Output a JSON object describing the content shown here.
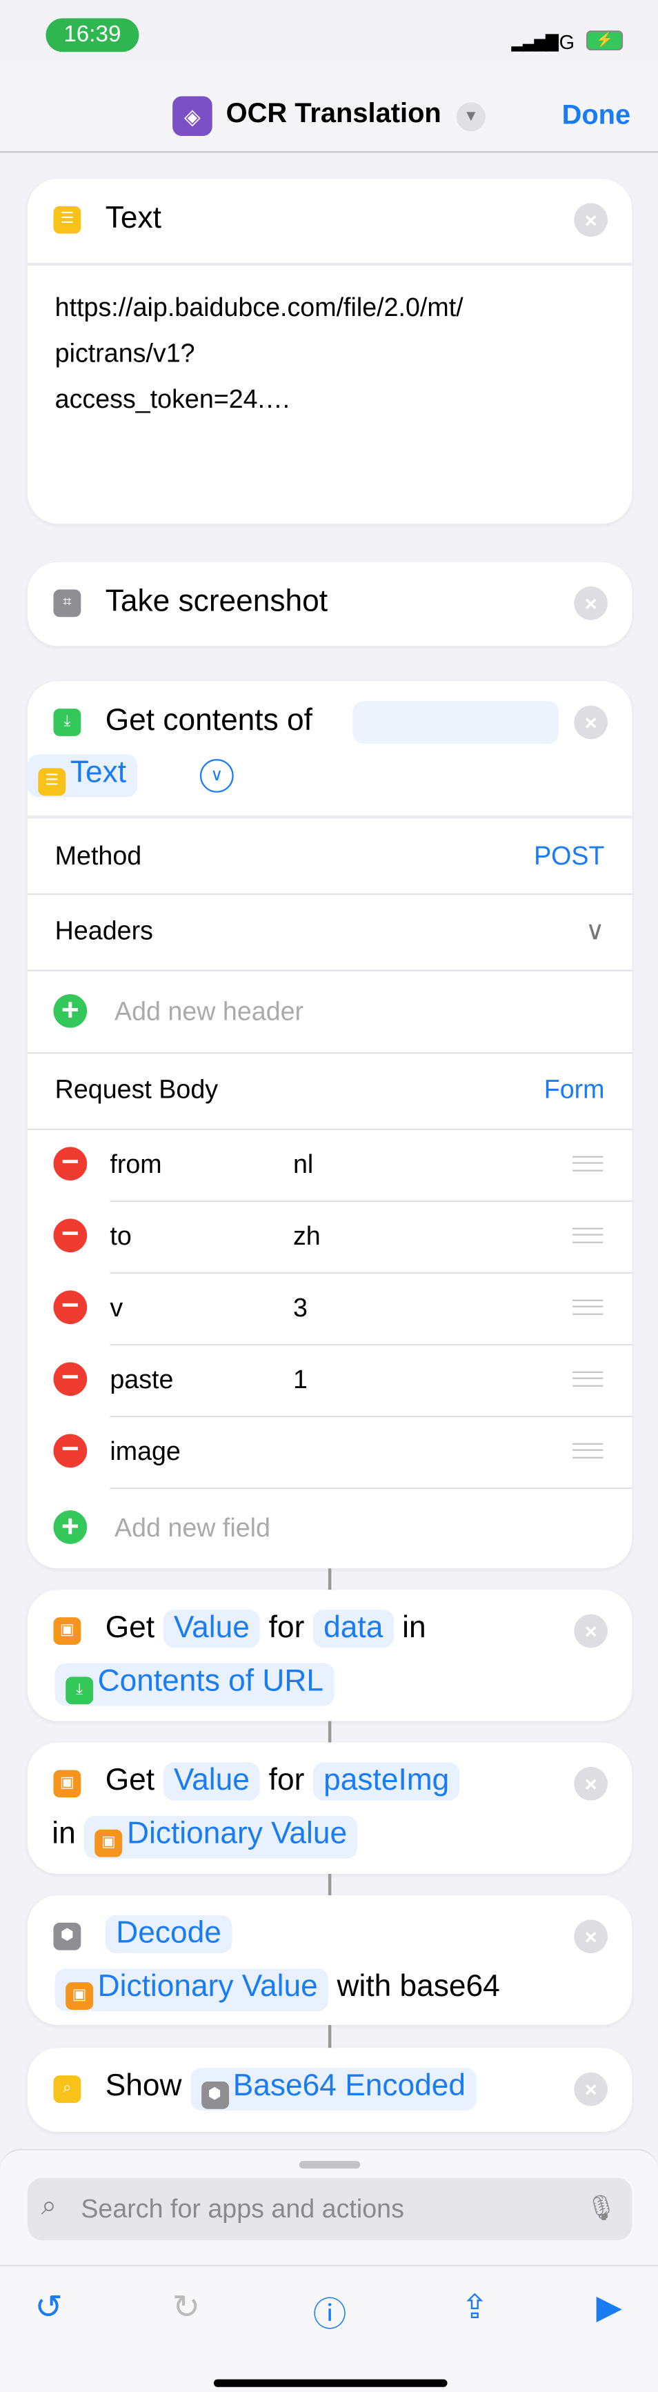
{
  "status": {
    "time": "16:39",
    "network": "5G"
  },
  "nav": {
    "title": "OCR Translation",
    "done": "Done",
    "app_icon": "shortcuts-icon"
  },
  "text_card": {
    "title": "Text",
    "lines": [
      "https://aip.baidubce.com/file/2.0/mt/",
      "pictrans/v1?",
      "access_token=24.…"
    ]
  },
  "screenshot_card": {
    "title": "Take screenshot"
  },
  "url_card": {
    "title": "Get contents of",
    "token": "Text",
    "method_label": "Method",
    "method_value": "POST",
    "headers_label": "Headers",
    "add_header": "Add new header",
    "body_label": "Request Body",
    "body_value": "Form",
    "fields": [
      {
        "key": "from",
        "value": "nl"
      },
      {
        "key": "to",
        "value": "zh"
      },
      {
        "key": "v",
        "value": "3"
      },
      {
        "key": "paste",
        "value": "1"
      },
      {
        "key": "image",
        "value": ""
      }
    ],
    "add_field": "Add new field"
  },
  "dict1": {
    "get": "Get",
    "value": "Value",
    "for": "for",
    "key": "data",
    "in": "in",
    "source": "Contents of URL"
  },
  "dict2": {
    "get": "Get",
    "value": "Value",
    "for": "for",
    "key": "pasteImg",
    "in": "in",
    "source": "Dictionary Value"
  },
  "decode": {
    "action": "Decode",
    "source": "Dictionary Value",
    "with": "with base64"
  },
  "show": {
    "action": "Show",
    "source": "Base64 Encoded"
  },
  "search": {
    "placeholder": "Search for apps and actions"
  },
  "colors": {
    "accent": "#1a7cf2",
    "text_icon": "#f8c21a",
    "dict_icon": "#f7941d",
    "url_icon": "#34c759",
    "base64_icon": "#8e8e93",
    "remove": "#f03b30"
  }
}
